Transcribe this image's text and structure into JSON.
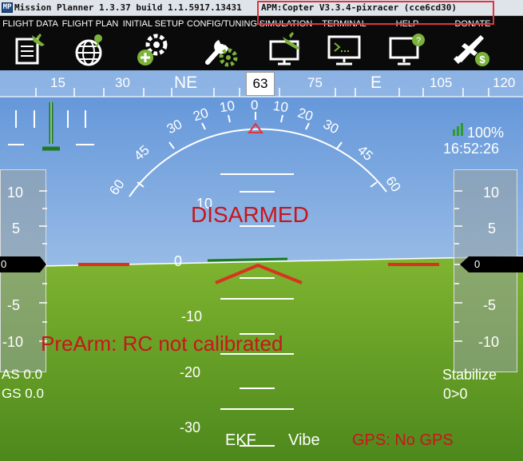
{
  "window": {
    "title": "Mission Planner 1.3.37 build 1.1.5917.13431",
    "firmware": "APM:Copter V3.3.4-pixracer (cce6cd30)"
  },
  "menu": {
    "items": [
      {
        "label": "FLIGHT DATA",
        "icon": "flight-data-icon"
      },
      {
        "label": "FLIGHT PLAN",
        "icon": "flight-plan-icon"
      },
      {
        "label": "INITIAL SETUP",
        "icon": "initial-setup-icon"
      },
      {
        "label": "CONFIG/TUNING",
        "icon": "config-tuning-icon"
      },
      {
        "label": "SIMULATION",
        "icon": "simulation-icon"
      },
      {
        "label": "TERMINAL",
        "icon": "terminal-icon"
      },
      {
        "label": "HELP",
        "icon": "help-icon"
      },
      {
        "label": "DONATE",
        "icon": "donate-icon"
      }
    ]
  },
  "hud": {
    "heading": {
      "current": "63",
      "labels": [
        "15",
        "30",
        "NE",
        "75",
        "E",
        "105",
        "120"
      ]
    },
    "roll_scale": [
      "60",
      "45",
      "30",
      "20",
      "10",
      "0",
      "10",
      "20",
      "30",
      "45",
      "60"
    ],
    "pitch_scale": [
      "10",
      "0",
      "-10",
      "-20",
      "-30"
    ],
    "status": "DISARMED",
    "prearm_message": "PreArm: RC not calibrated",
    "speed_tape": {
      "ticks": [
        "10",
        "5",
        "0",
        "-5",
        "-10"
      ],
      "current": "0"
    },
    "altitude_tape": {
      "ticks": [
        "10",
        "5",
        "0",
        "-5",
        "-10"
      ],
      "current": "0"
    },
    "airspeed": "AS 0.0",
    "groundspeed": "GS 0.0",
    "battery_link": "100%",
    "clock": "16:52:26",
    "mode": "Stabilize",
    "mode_detail": "0>0",
    "ekf_label": "EKF",
    "vibe_label": "Vibe",
    "gps_status": "GPS: No GPS",
    "colors": {
      "sky_top": "#5d92d8",
      "sky_bottom": "#cfe3f4",
      "ground_top": "#79b12a",
      "ground_bottom": "#4f8a1c",
      "warning": "#c8151b"
    }
  }
}
